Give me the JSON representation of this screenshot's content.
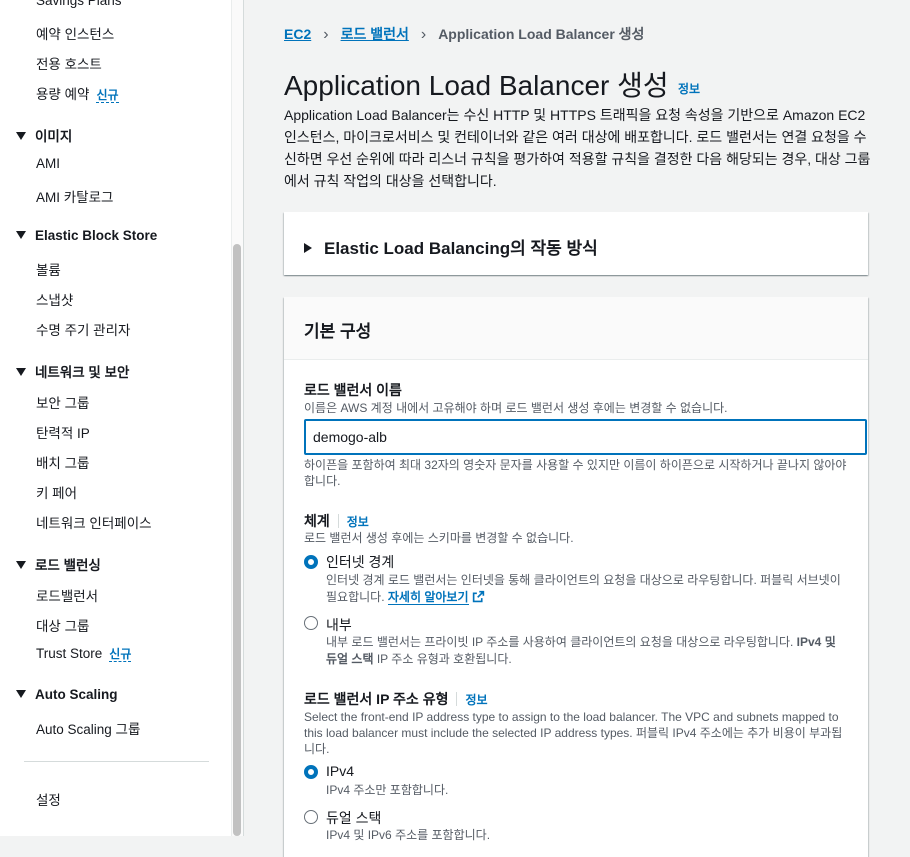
{
  "sidebar": {
    "items_top": [
      {
        "label": "Savings Plans"
      },
      {
        "label": "예약 인스턴스"
      },
      {
        "label": "전용 호스트"
      },
      {
        "label": "용량 예약",
        "badge": "신규"
      }
    ],
    "sections": [
      {
        "title": "이미지",
        "items": [
          {
            "label": "AMI"
          },
          {
            "label": "AMI 카탈로그"
          }
        ]
      },
      {
        "title": "Elastic Block Store",
        "items": [
          {
            "label": "볼륨"
          },
          {
            "label": "스냅샷"
          },
          {
            "label": "수명 주기 관리자"
          }
        ]
      },
      {
        "title": "네트워크 및 보안",
        "items": [
          {
            "label": "보안 그룹"
          },
          {
            "label": "탄력적 IP"
          },
          {
            "label": "배치 그룹"
          },
          {
            "label": "키 페어"
          },
          {
            "label": "네트워크 인터페이스"
          }
        ]
      },
      {
        "title": "로드 밸런싱",
        "items": [
          {
            "label": "로드밸런서"
          },
          {
            "label": "대상 그룹"
          },
          {
            "label": "Trust Store",
            "badge": "신규"
          }
        ]
      },
      {
        "title": "Auto Scaling",
        "items": [
          {
            "label": "Auto Scaling 그룹"
          }
        ]
      }
    ],
    "footer_item": "설정"
  },
  "breadcrumb": {
    "items": [
      "EC2",
      "로드 밸런서"
    ],
    "current": "Application Load Balancer 생성"
  },
  "header": {
    "title": "Application Load Balancer 생성",
    "info": "정보",
    "description": "Application Load Balancer는 수신 HTTP 및 HTTPS 트래픽을 요청 속성을 기반으로 Amazon EC2 인스턴스, 마이크로서비스 및 컨테이너와 같은 여러 대상에 배포합니다. 로드 밸런서는 연결 요청을 수신하면 우선 순위에 따라 리스너 규칙을 평가하여 적용할 규칙을 결정한 다음 해당되는 경우, 대상 그룹에서 규칙 작업의 대상을 선택합니다."
  },
  "expander": {
    "title": "Elastic Load Balancing의 작동 방식"
  },
  "config": {
    "title": "기본 구성",
    "name": {
      "label": "로드 밸런서 이름",
      "description": "이름은 AWS 계정 내에서 고유해야 하며 로드 밸런서 생성 후에는 변경할 수 없습니다.",
      "value": "demogo-alb",
      "constraint": "하이픈을 포함하여 최대 32자의 영숫자 문자를 사용할 수 있지만 이름이 하이픈으로 시작하거나 끝나지 않아야 합니다."
    },
    "scheme": {
      "label": "체계",
      "info": "정보",
      "description": "로드 밸런서 생성 후에는 스키마를 변경할 수 없습니다.",
      "options": [
        {
          "label": "인터넷 경계",
          "checked": true,
          "description": "인터넷 경계 로드 밸런서는 인터넷을 통해 클라이언트의 요청을 대상으로 라우팅합니다. 퍼블릭 서브넷이 필요합니다.",
          "link": "자세히 알아보기"
        },
        {
          "label": "내부",
          "checked": false,
          "description": "내부 로드 밸런서는 프라이빗 IP 주소를 사용하여 클라이언트의 요청을 대상으로 라우팅합니다.",
          "description_bold": "IPv4 및 듀얼 스택",
          "description_tail": " IP 주소 유형과 호환됩니다."
        }
      ]
    },
    "ip_type": {
      "label": "로드 밸런서 IP 주소 유형",
      "info": "정보",
      "description": "Select the front-end IP address type to assign to the load balancer. The VPC and subnets mapped to this load balancer must include the selected IP address types. 퍼블릭 IPv4 주소에는 추가 비용이 부과됩니다.",
      "options": [
        {
          "label": "IPv4",
          "checked": true,
          "description": "IPv4 주소만 포함합니다."
        },
        {
          "label": "듀얼 스택",
          "checked": false,
          "description": "IPv4 및 IPv6 주소를 포함합니다."
        }
      ]
    }
  }
}
